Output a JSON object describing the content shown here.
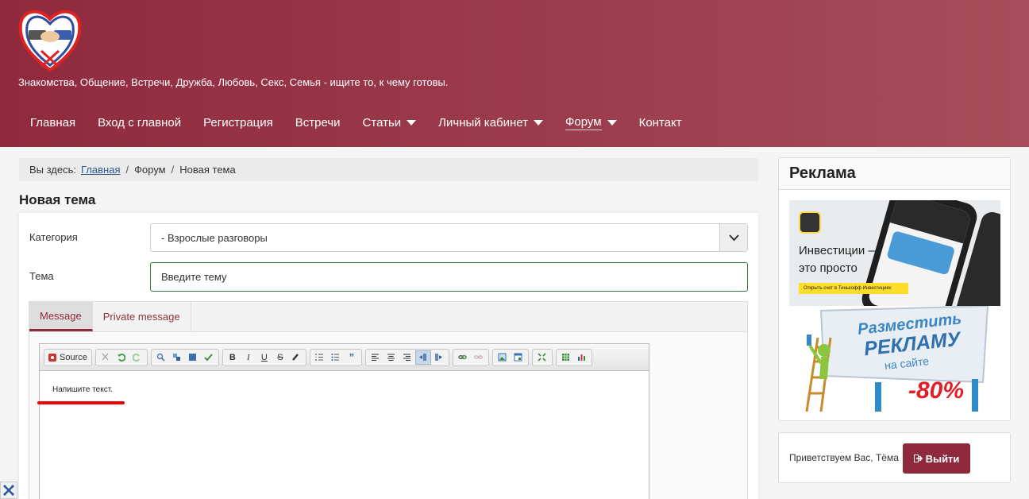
{
  "header": {
    "tagline": "Знакомства, Общение, Встречи, Дружба, Любовь, Секс, Семья - ищите то, к чему готовы.",
    "brand_color": "#8f2a3d"
  },
  "nav": {
    "items": [
      {
        "label": "Главная",
        "dropdown": false
      },
      {
        "label": "Вход с главной",
        "dropdown": false
      },
      {
        "label": "Регистрация",
        "dropdown": false
      },
      {
        "label": "Встречи",
        "dropdown": false
      },
      {
        "label": "Статьи",
        "dropdown": true
      },
      {
        "label": "Личный кабинет",
        "dropdown": true
      },
      {
        "label": "Форум",
        "dropdown": true
      },
      {
        "label": "Контакт",
        "dropdown": false
      }
    ]
  },
  "breadcrumb": {
    "prefix": "Вы здесь:",
    "home": "Главная",
    "forum": "Форум",
    "current": "Новая тема",
    "separator": "/"
  },
  "page": {
    "title": "Новая тема"
  },
  "form": {
    "category_label": "Категория",
    "category_value": "- Взрослые разговоры",
    "topic_label": "Тема",
    "topic_placeholder": "Введите тему",
    "tabs": [
      {
        "label": "Message",
        "active": true
      },
      {
        "label": "Private message",
        "active": false
      }
    ],
    "editor": {
      "source_label": "Source",
      "placeholder_text": "Напишите текст."
    }
  },
  "sidebar": {
    "ad_title": "Реклама",
    "ad1": {
      "line1": "Инвестиции —",
      "line2": "это просто",
      "cta": "Открыть счет в Тинькофф Инвестициях"
    },
    "ad2": {
      "line1": "Разместить",
      "line2": "РЕКЛАМУ",
      "line3": "на сайте",
      "discount": "-80%"
    },
    "greeting": "Приветствуем Вас, Тёма",
    "logout_label": "Выйти"
  }
}
